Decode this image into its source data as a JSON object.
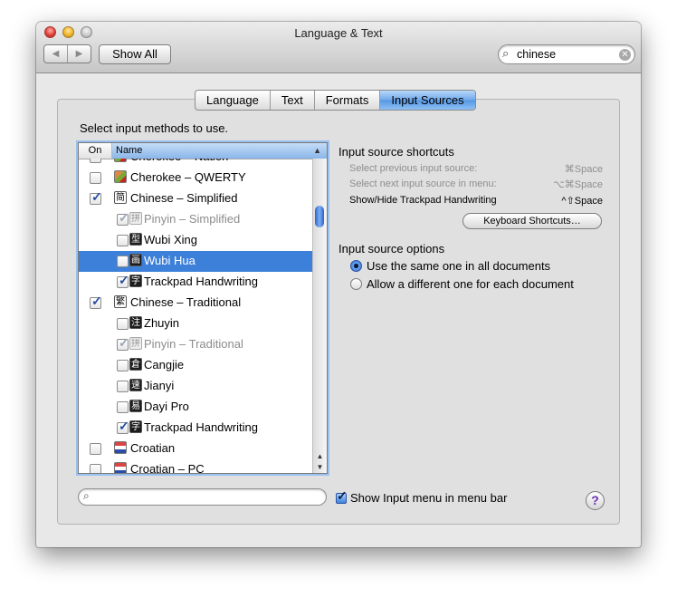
{
  "window": {
    "title": "Language & Text"
  },
  "toolbar": {
    "back": "◀",
    "forward": "▶",
    "show_all": "Show All"
  },
  "search": {
    "value": "chinese",
    "icon": "search-icon",
    "clear": "✕"
  },
  "tabs": [
    {
      "label": "Language",
      "active": false
    },
    {
      "label": "Text",
      "active": false
    },
    {
      "label": "Formats",
      "active": false
    },
    {
      "label": "Input Sources",
      "active": true
    }
  ],
  "instructions": "Select input methods to use.",
  "list": {
    "header_on": "On",
    "header_name": "Name",
    "sort_arrow": "▲",
    "rows": [
      {
        "name": "Cherokee – Nation",
        "checked": false,
        "indent": false,
        "dim": false,
        "icon": "cherokee-flag-icon",
        "glyph": "",
        "selected": false
      },
      {
        "name": "Cherokee – QWERTY",
        "checked": false,
        "indent": false,
        "dim": false,
        "icon": "cherokee-flag-icon",
        "glyph": "",
        "selected": false
      },
      {
        "name": "Chinese – Simplified",
        "checked": true,
        "indent": false,
        "dim": false,
        "icon": "chinese-simplified-icon",
        "glyph": "简",
        "selected": false
      },
      {
        "name": "Pinyin – Simplified",
        "checked": true,
        "indent": true,
        "dim": true,
        "icon": "pinyin-icon",
        "glyph": "拼",
        "selected": false
      },
      {
        "name": "Wubi Xing",
        "checked": false,
        "indent": true,
        "dim": false,
        "icon": "wubi-xing-icon",
        "glyph": "型",
        "selected": false
      },
      {
        "name": "Wubi Hua",
        "checked": false,
        "indent": true,
        "dim": false,
        "icon": "wubi-hua-icon",
        "glyph": "画",
        "selected": true
      },
      {
        "name": "Trackpad Handwriting",
        "checked": true,
        "indent": true,
        "dim": false,
        "icon": "handwriting-icon",
        "glyph": "字",
        "selected": false
      },
      {
        "name": "Chinese – Traditional",
        "checked": true,
        "indent": false,
        "dim": false,
        "icon": "chinese-traditional-icon",
        "glyph": "繁",
        "selected": false
      },
      {
        "name": "Zhuyin",
        "checked": false,
        "indent": true,
        "dim": false,
        "icon": "zhuyin-icon",
        "glyph": "注",
        "selected": false
      },
      {
        "name": "Pinyin – Traditional",
        "checked": true,
        "indent": true,
        "dim": true,
        "icon": "pinyin-icon",
        "glyph": "拼",
        "selected": false
      },
      {
        "name": "Cangjie",
        "checked": false,
        "indent": true,
        "dim": false,
        "icon": "cangjie-icon",
        "glyph": "倉",
        "selected": false
      },
      {
        "name": "Jianyi",
        "checked": false,
        "indent": true,
        "dim": false,
        "icon": "jianyi-icon",
        "glyph": "速",
        "selected": false
      },
      {
        "name": "Dayi Pro",
        "checked": false,
        "indent": true,
        "dim": false,
        "icon": "dayi-icon",
        "glyph": "易",
        "selected": false
      },
      {
        "name": "Trackpad Handwriting",
        "checked": true,
        "indent": true,
        "dim": false,
        "icon": "handwriting-icon",
        "glyph": "字",
        "selected": false
      },
      {
        "name": "Croatian",
        "checked": false,
        "indent": false,
        "dim": false,
        "icon": "croatia-flag-icon",
        "glyph": "",
        "selected": false
      },
      {
        "name": "Croatian – PC",
        "checked": false,
        "indent": false,
        "dim": false,
        "icon": "croatia-flag-icon",
        "glyph": "",
        "selected": false
      }
    ]
  },
  "shortcuts": {
    "title": "Input source shortcuts",
    "items": [
      {
        "label": "Select previous input source:",
        "key": "⌘Space",
        "active": false
      },
      {
        "label": "Select next input source in menu:",
        "key": "⌥⌘Space",
        "active": false
      },
      {
        "label": "Show/Hide Trackpad Handwriting",
        "key": "^⇧Space",
        "active": true
      }
    ],
    "button": "Keyboard Shortcuts…"
  },
  "options": {
    "title": "Input source options",
    "radios": [
      {
        "label": "Use the same one in all documents",
        "selected": true
      },
      {
        "label": "Allow a different one for each document",
        "selected": false
      }
    ]
  },
  "bottom": {
    "show_input_menu": "Show Input menu in menu bar",
    "show_input_menu_checked": true,
    "help": "?"
  }
}
